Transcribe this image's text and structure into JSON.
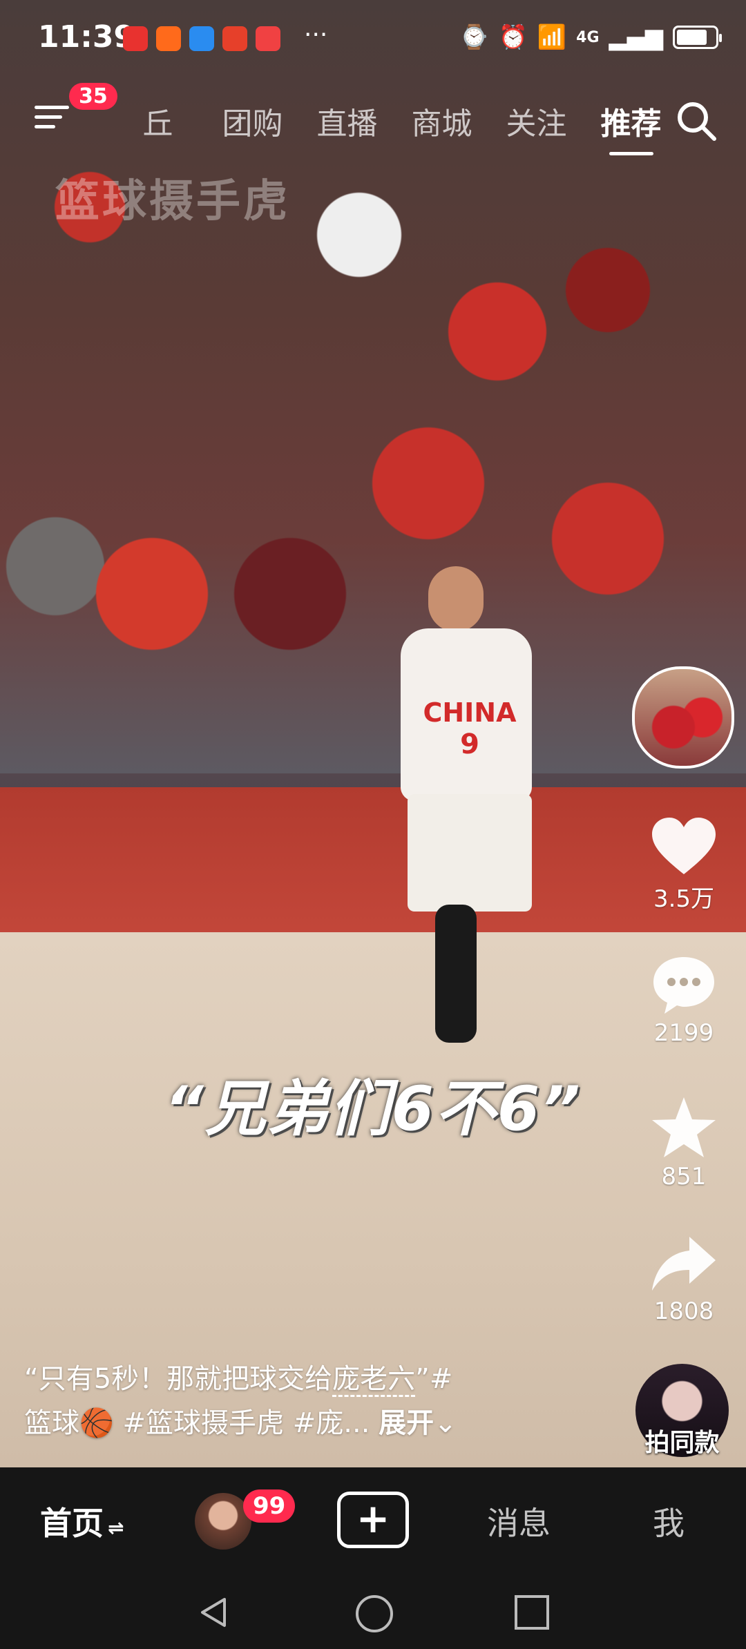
{
  "status_bar": {
    "time": "11:39",
    "more": "···",
    "network": "4G",
    "battery_level": 0.8,
    "app_icons": [
      "huawei-appgallery-icon",
      "taobao-icon",
      "browser-icon",
      "weibo-icon",
      "toutiao-icon"
    ]
  },
  "top_nav": {
    "notification_count": "35",
    "tabs": [
      "丘",
      "团购",
      "直播",
      "商城",
      "关注",
      "推荐"
    ],
    "active_tab": "推荐"
  },
  "video": {
    "watermark": "篮球摄手虎",
    "caption": "“兄弟们6不6”",
    "jersey_text": "CHINA",
    "jersey_number": "9"
  },
  "rail": {
    "likes": "3.5万",
    "comments": "2199",
    "favorites": "851",
    "shares": "1808"
  },
  "description": {
    "line1_prefix": "“只有5秒！那就把球交给",
    "line1_highlight": "庞老六",
    "line1_suffix": "”#",
    "line2": "篮球🏀 #篮球摄手虎 #庞... ",
    "expand": "展开"
  },
  "same_take": {
    "label": "拍同款"
  },
  "bottom_bar": {
    "home": "首页",
    "message_badge": "99",
    "messages": "消息",
    "me": "我"
  },
  "colors": {
    "badge": "#ff2a4e",
    "bar_bg": "#161616"
  }
}
